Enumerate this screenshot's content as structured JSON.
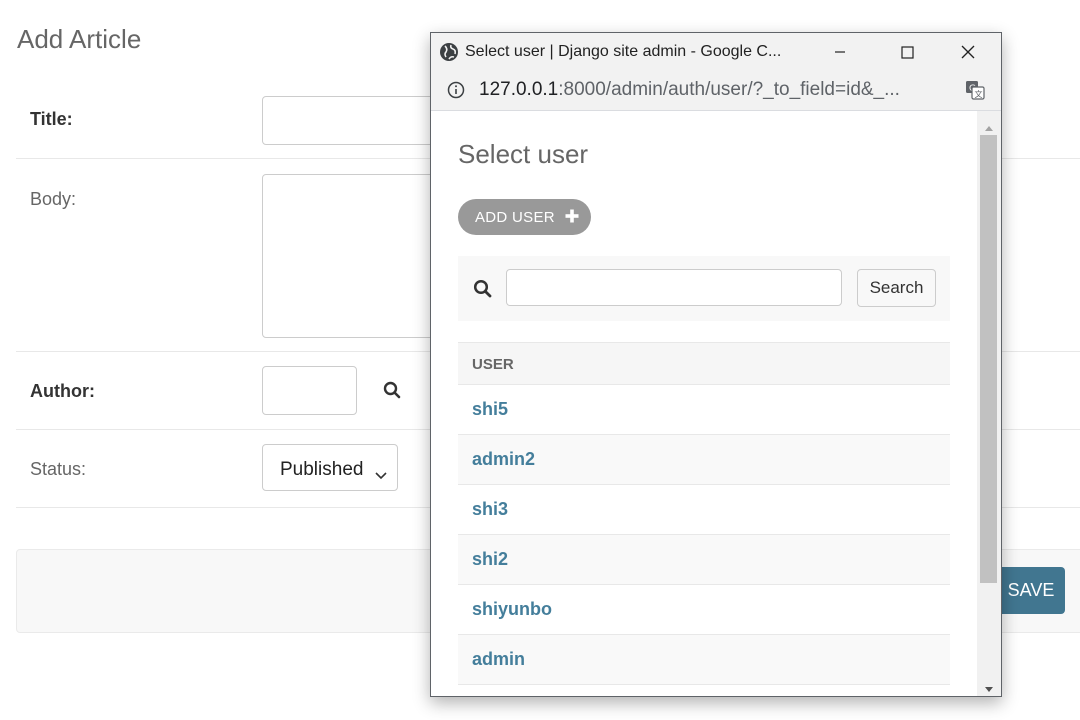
{
  "form": {
    "title": "Add Article",
    "fields": {
      "title_label": "Title:",
      "body_label": "Body:",
      "author_label": "Author:",
      "status_label": "Status:",
      "status_value": "Published"
    },
    "save_label": "SAVE"
  },
  "popup": {
    "window_title": "Select user | Django site admin - Google C...",
    "url_host": "127.0.0.1",
    "url_rest": ":8000/admin/auth/user/?_to_field=id&_...",
    "heading": "Select user",
    "add_user_label": "ADD USER",
    "search": {
      "button_label": "Search",
      "value": ""
    },
    "table": {
      "column_header": "USER",
      "rows": [
        "shi5",
        "admin2",
        "shi3",
        "shi2",
        "shiyunbo",
        "admin"
      ]
    }
  },
  "colors": {
    "link": "#447e9b",
    "save_button": "#417690",
    "add_user_button": "#999999"
  },
  "icons": [
    "globe-icon",
    "minimize-icon",
    "maximize-icon",
    "close-icon",
    "info-icon",
    "translate-icon",
    "search-icon",
    "plus-icon",
    "chevron-down-icon",
    "magnifier-lookup-icon"
  ]
}
